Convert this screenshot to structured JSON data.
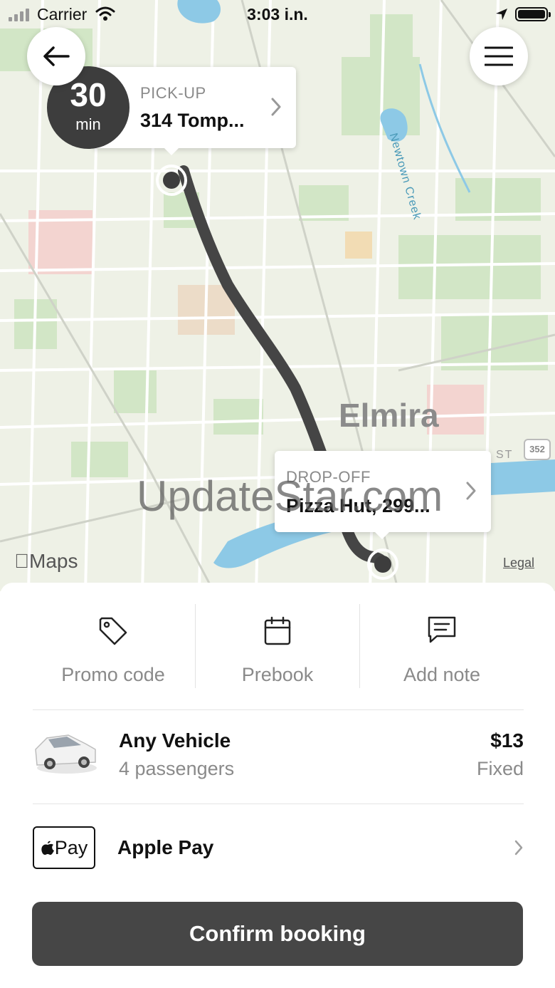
{
  "status_bar": {
    "carrier": "Carrier",
    "time": "3:03 i.n."
  },
  "map": {
    "city_label": "Elmira",
    "street_label": "ST",
    "route_shield": "352",
    "creek_label": "Newtown Creek",
    "watermark": "UpdateStar.com",
    "maps_logo": "Maps",
    "legal_link": "Legal"
  },
  "pickup": {
    "eta_value": "30",
    "eta_unit": "min",
    "label": "PICK-UP",
    "address": "314 Tomp..."
  },
  "dropoff": {
    "label": "DROP-OFF",
    "address": "Pizza Hut, 299..."
  },
  "actions": [
    {
      "label": "Promo code",
      "icon": "tag-icon"
    },
    {
      "label": "Prebook",
      "icon": "calendar-icon"
    },
    {
      "label": "Add note",
      "icon": "message-icon"
    }
  ],
  "vehicle": {
    "name": "Any Vehicle",
    "passengers": "4 passengers",
    "price": "$13",
    "price_type": "Fixed"
  },
  "payment": {
    "badge": "Pay",
    "method": "Apple Pay"
  },
  "confirm_label": "Confirm booking",
  "colors": {
    "route": "#454545",
    "button": "#464646",
    "water": "#8dc9e6",
    "park": "#cfe3c5",
    "muted_text": "#8a8a8a"
  }
}
